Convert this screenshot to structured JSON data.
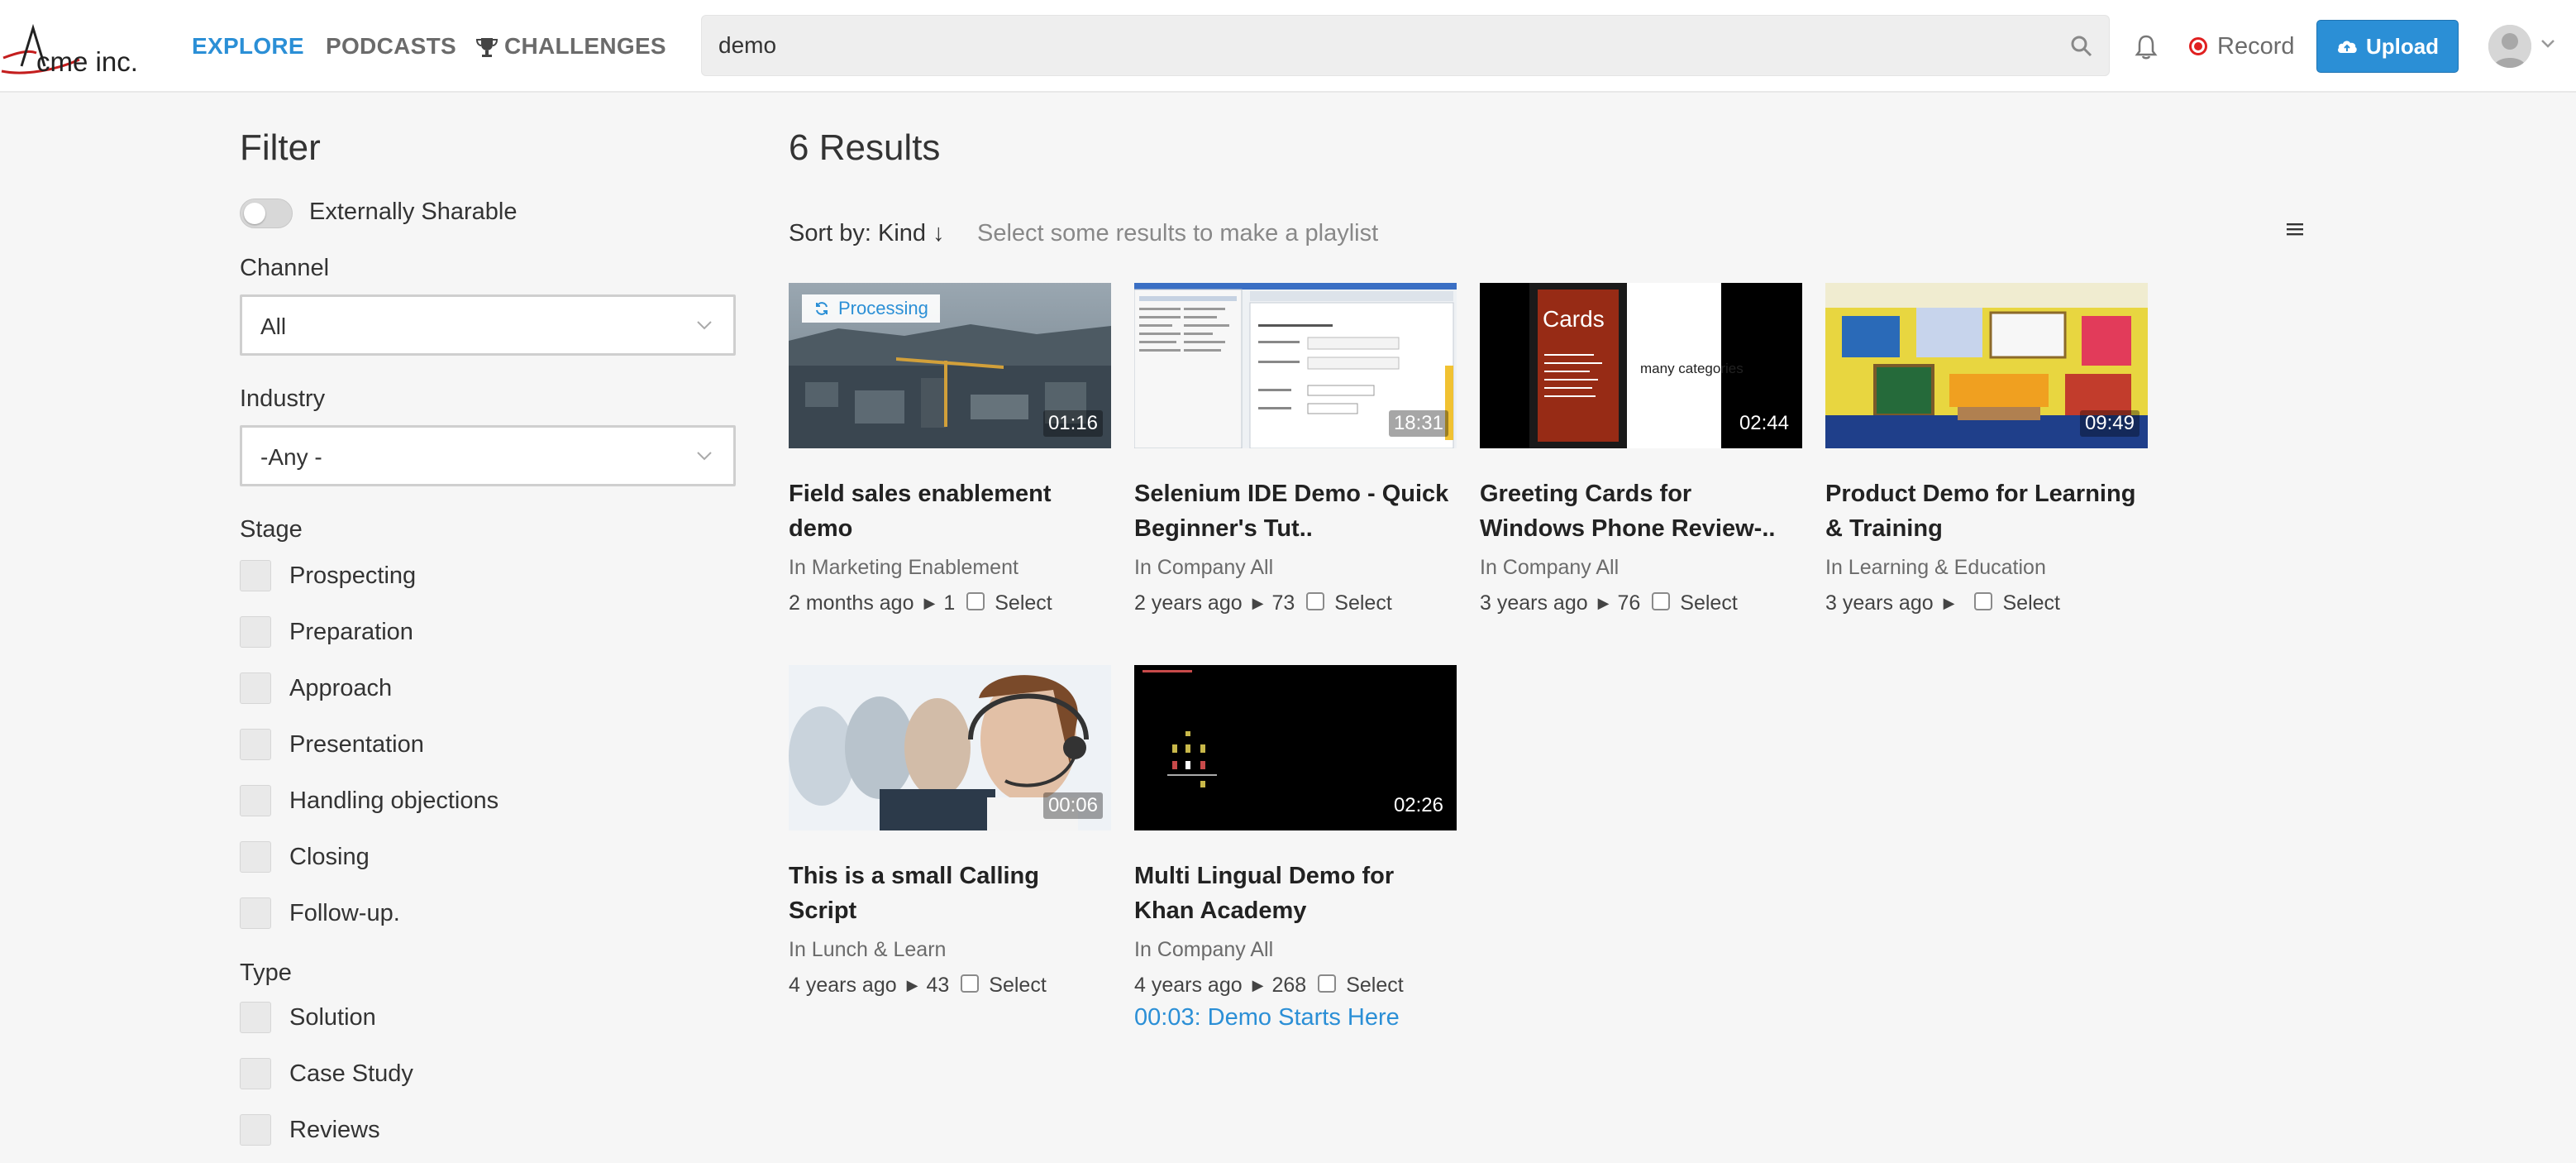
{
  "header": {
    "logo_text": "cme inc.",
    "nav": [
      {
        "label": "EXPLORE"
      },
      {
        "label": "PODCASTS"
      },
      {
        "label": "CHALLENGES"
      }
    ],
    "search_value": "demo",
    "record_label": "Record",
    "upload_label": "Upload"
  },
  "filter": {
    "title": "Filter",
    "externally_sharable_label": "Externally Sharable",
    "channel_label": "Channel",
    "channel_value": "All",
    "industry_label": "Industry",
    "industry_value": "-Any -",
    "stage_label": "Stage",
    "stages": [
      "Prospecting",
      "Preparation",
      "Approach",
      "Presentation",
      "Handling objections",
      "Closing",
      "Follow-up."
    ],
    "type_label": "Type",
    "types": [
      "Solution",
      "Case Study",
      "Reviews"
    ]
  },
  "results": {
    "title": "6 Results",
    "sort_label": "Sort by: Kind ↓",
    "playlist_hint": "Select some results to make a playlist",
    "select_label": "Select",
    "processing_label": "Processing",
    "cards": [
      {
        "title_line1": "Field sales enablement",
        "title_line2": "demo",
        "channel": "In Marketing Enablement",
        "age": "2 months ago",
        "views": "1",
        "duration": "01:16"
      },
      {
        "title_line1": "Selenium IDE Demo - Quick",
        "title_line2": "Beginner's Tut..",
        "channel": "In Company All",
        "age": "2 years ago",
        "views": "73",
        "duration": "18:31"
      },
      {
        "title_line1": "Greeting Cards for",
        "title_line2": "Windows Phone Review-..",
        "channel": "In Company All",
        "age": "3 years ago",
        "views": "76",
        "duration": "02:44",
        "thumb_text": "many categories",
        "thumb_phone_text": "Cards"
      },
      {
        "title_line1": "Product Demo for Learning",
        "title_line2": "& Training",
        "channel": "In Learning & Education",
        "age": "3 years ago",
        "views": "",
        "duration": "09:49"
      },
      {
        "title_line1": "This is a small Calling Script",
        "title_line2": "",
        "channel": "In Lunch & Learn",
        "age": "4 years ago",
        "views": "43",
        "duration": "00:06"
      },
      {
        "title_line1": "Multi Lingual Demo for",
        "title_line2": "Khan Academy",
        "channel": "In Company All",
        "age": "4 years ago",
        "views": "268",
        "duration": "02:26",
        "chapter_link": "00:03:  Demo Starts Here"
      }
    ]
  },
  "colors": {
    "accent": "#2b8fd6",
    "record": "#e02020",
    "background": "#f6f6f6"
  }
}
